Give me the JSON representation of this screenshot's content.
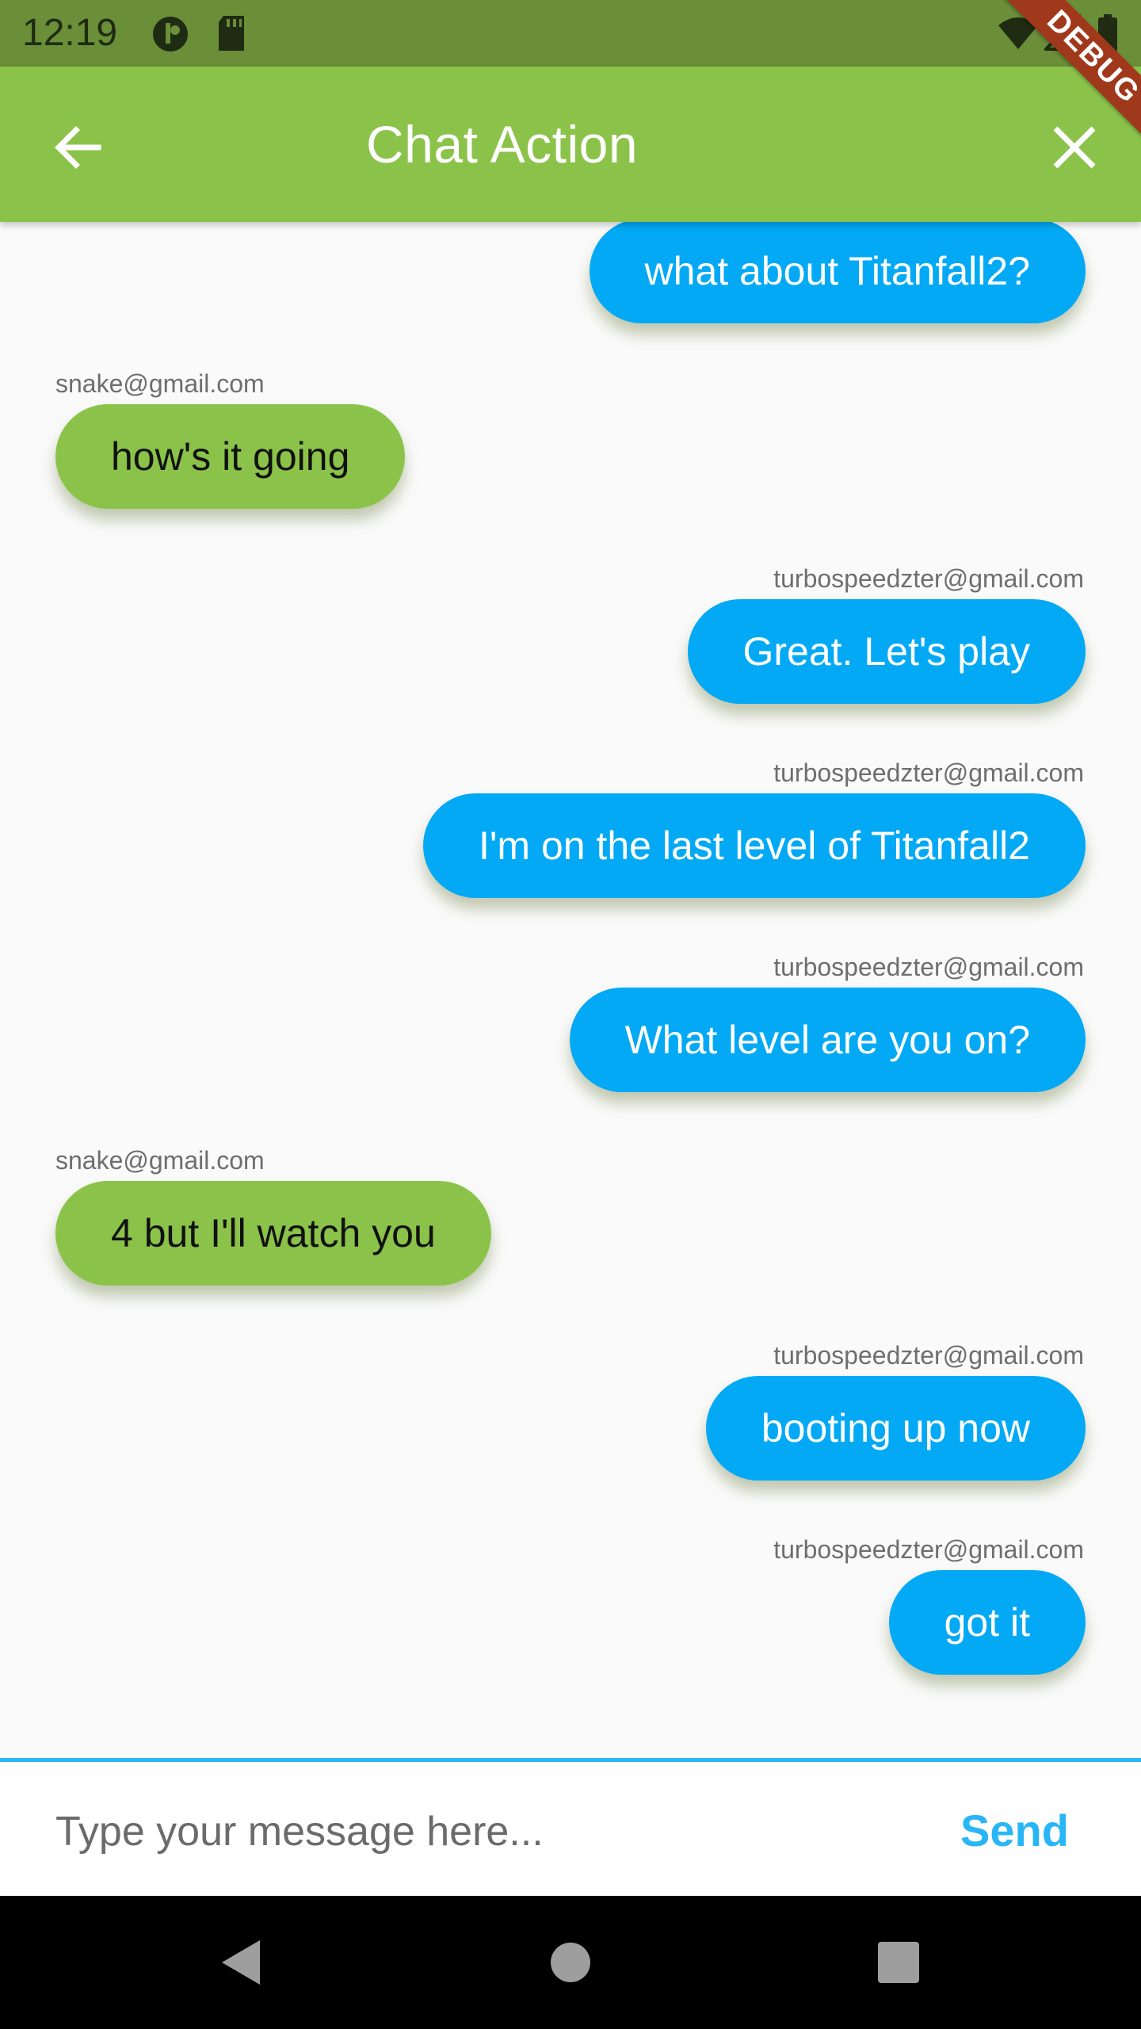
{
  "status_bar": {
    "time": "12:19",
    "icons": [
      "notification-icon",
      "sd-card-icon",
      "wifi-icon",
      "signal-icon",
      "battery-icon"
    ]
  },
  "app_bar": {
    "title": "Chat Action",
    "back_icon": "arrow-back-icon",
    "close_icon": "close-icon",
    "debug_label": "DEBUG"
  },
  "messages": [
    {
      "sender": "",
      "text": "what about Titanfall2?",
      "side": "right"
    },
    {
      "sender": "snake@gmail.com",
      "text": "how's it going",
      "side": "left"
    },
    {
      "sender": "turbospeedzter@gmail.com",
      "text": "Great.  Let's play",
      "side": "right"
    },
    {
      "sender": "turbospeedzter@gmail.com",
      "text": "I'm on the last level of Titanfall2",
      "side": "right"
    },
    {
      "sender": "turbospeedzter@gmail.com",
      "text": "What level are you on?",
      "side": "right"
    },
    {
      "sender": "snake@gmail.com",
      "text": "4 but I'll watch you",
      "side": "left"
    },
    {
      "sender": "turbospeedzter@gmail.com",
      "text": "booting up now",
      "side": "right"
    },
    {
      "sender": "turbospeedzter@gmail.com",
      "text": "got it",
      "side": "right"
    }
  ],
  "composer": {
    "placeholder": "Type your message here...",
    "value": "",
    "send_label": "Send"
  },
  "nav_bar": {
    "icons": [
      "back-triangle-icon",
      "home-circle-icon",
      "recents-square-icon"
    ]
  },
  "colors": {
    "app_bar": "#8bc34a",
    "status_bar": "#6b8e38",
    "own_bubble": "#03a9f4",
    "other_bubble": "#8bc34a",
    "send": "#29b6f6",
    "debug_banner": "#a0381b"
  }
}
